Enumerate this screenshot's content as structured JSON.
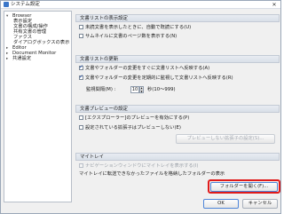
{
  "window": {
    "title": "システム設定",
    "close_glyph": "✕"
  },
  "tree": {
    "items": [
      {
        "label": "Browser",
        "expander": "▾",
        "level": 0
      },
      {
        "label": "表示設定",
        "level": 1
      },
      {
        "label": "文書の構成/操作",
        "level": 1
      },
      {
        "label": "共有文書の管理",
        "level": 1
      },
      {
        "label": "ファクス",
        "level": 1
      },
      {
        "label": "ダイアログボックスの表示",
        "level": 1
      },
      {
        "label": "Editor",
        "expander": "▸",
        "level": 0
      },
      {
        "label": "Document Monitor",
        "expander": "▸",
        "level": 0
      },
      {
        "label": "共通設定",
        "expander": "▸",
        "level": 0
      }
    ]
  },
  "sections": {
    "list_display": {
      "header": "文書リストの表示設定",
      "opt1": "未読文書を表示したときに、自動で既読にする(U)",
      "opt2": "サムネイルに文書のページ数を表示する(N)"
    },
    "list_update": {
      "header": "文書リストの更新",
      "opt1": "文書やフォルダーの変更をすぐに文書リストへ反映する(A)",
      "opt2": "文書やフォルダーの変更を定期的に監視して文書リストへ反映する(R)",
      "interval_label": "監視間隔(M) :",
      "interval_value": "10",
      "interval_unit": "秒(10〜999)"
    },
    "preview": {
      "header": "文書プレビューの設定",
      "opt1": "[エクスプローラー]のプレビューを有効にする(P)",
      "opt2": "設定されている拡張子はプレビューしない(E)",
      "button": "プレビューしない拡張子の設定(S)..."
    },
    "mytray": {
      "header": "マイトレイ",
      "opt1": "ナビゲーションウィンドウにマイトレイを表示する(I)",
      "note": "マイトレイに転送できなかったファイルを格納したフォルダーの表示",
      "button": "フォルダーを開く(F)..."
    }
  },
  "footer": {
    "ok": "OK",
    "cancel": "キャンセル"
  },
  "colors": {
    "highlight": "#e01b1b",
    "accent": "#4f86d9"
  }
}
